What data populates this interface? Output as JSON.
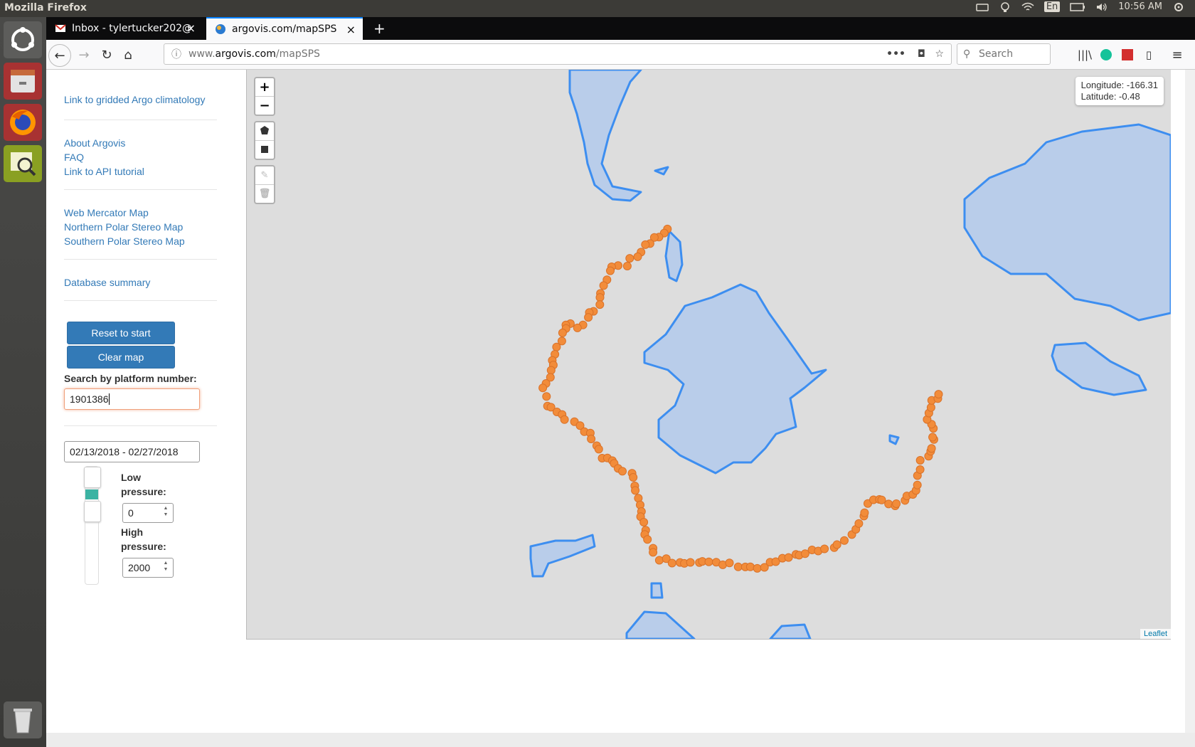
{
  "os": {
    "window_title": "Mozilla Firefox",
    "keyboard_layout": "En",
    "clock": "10:56 AM"
  },
  "browser": {
    "tabs": [
      {
        "label": "Inbox - tylertucker202@"
      },
      {
        "label": "argovis.com/mapSPS"
      }
    ],
    "url": {
      "prefix": "www.",
      "domain": "argovis.com",
      "path": "/mapSPS"
    },
    "search_placeholder": "Search"
  },
  "sidebar": {
    "links_group1": [
      "Link to gridded Argo climatology"
    ],
    "links_group2": [
      "About Argovis",
      "FAQ",
      "Link to API tutorial"
    ],
    "links_group3": [
      "Web Mercator Map",
      "Northern Polar Stereo Map",
      "Southern Polar Stereo Map"
    ],
    "links_group4": [
      "Database summary"
    ],
    "reset_button": "Reset to start",
    "clear_button": "Clear map",
    "platform_label": "Search by platform number:",
    "platform_value": "1901386",
    "date_range": "02/13/2018 - 02/27/2018",
    "low_pressure_label": "Low pressure:",
    "low_pressure_value": "0",
    "high_pressure_label": "High pressure:",
    "high_pressure_value": "2000"
  },
  "map": {
    "zoom_in": "+",
    "zoom_out": "−",
    "coord_longitude": "Longitude: -166.31",
    "coord_latitude": "Latitude: -0.48",
    "attribution": "Leaflet",
    "land_color": "#b9cdea",
    "coast_color": "#3d8ef0",
    "track_color": "#f28c3a",
    "track_points_count_note": ""
  }
}
